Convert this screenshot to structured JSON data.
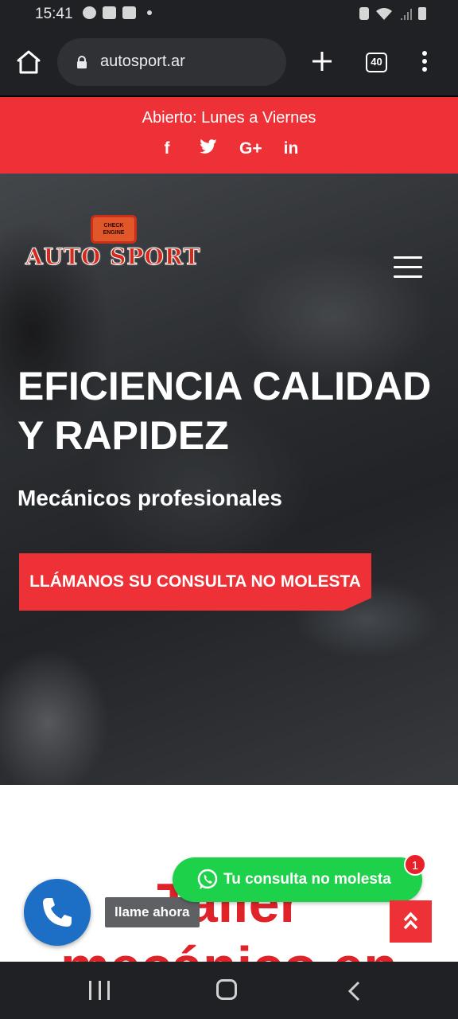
{
  "status": {
    "time": "15:41"
  },
  "browser": {
    "url": "autosport.ar",
    "tab_count": "40"
  },
  "topbar": {
    "hours": "Abierto: Lunes a Viernes",
    "social": [
      {
        "icon": "facebook-icon",
        "glyph": "f"
      },
      {
        "icon": "twitter-icon",
        "glyph": "🐦"
      },
      {
        "icon": "google-plus-icon",
        "glyph": "G+"
      },
      {
        "icon": "linkedin-icon",
        "glyph": "in"
      }
    ]
  },
  "hero": {
    "logo_engine_text": "CHECK ENGINE",
    "logo_text": "AUTO SPORT",
    "title": "EFICIENCIA CALIDAD Y RAPIDEZ",
    "subtitle": "Mecánicos profesionales",
    "cta": "LLÁMANOS SU CONSULTA NO MOLESTA"
  },
  "section": {
    "title_line1": "Taller",
    "title_line2": "mecánico en"
  },
  "floating": {
    "call_tooltip": "llame ahora",
    "whatsapp_label": "Tu consulta no molesta",
    "whatsapp_badge": "1"
  },
  "colors": {
    "brand_red": "#ee3136",
    "whatsapp_green": "#1ed14a",
    "call_blue": "#1c6fc4"
  }
}
